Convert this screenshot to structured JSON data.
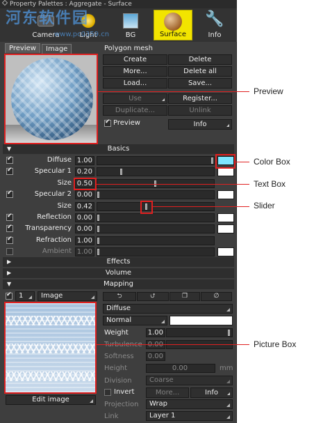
{
  "window": {
    "title": "Property Palettes : Aggregate - Surface"
  },
  "watermark": {
    "text": "河东软件园",
    "url": "www.pc0359.cn"
  },
  "toolbar": {
    "camera": "Camera",
    "light": "Light",
    "bg": "BG",
    "surface": "Surface",
    "info": "Info"
  },
  "tabs": {
    "preview": "Preview",
    "image": "Image"
  },
  "mesh": {
    "title": "Polygon mesh",
    "create": "Create",
    "delete": "Delete",
    "more": "More...",
    "delete_all": "Delete all",
    "load": "Load...",
    "save": "Save...",
    "use": "Use",
    "register": "Register...",
    "duplicate": "Duplicate...",
    "unlink": "Unlink",
    "preview_check": "Preview",
    "info": "Info"
  },
  "basics": {
    "header": "Basics",
    "rows": [
      {
        "label": "Diffuse",
        "value": "1.00",
        "level": 1.0,
        "checked": true,
        "swatch": "#7fe6ff",
        "enabled": true
      },
      {
        "label": "Specular 1",
        "value": "0.20",
        "level": 0.2,
        "checked": true,
        "swatch": "#ffffff",
        "enabled": true
      },
      {
        "label": "Size",
        "value": "0.50",
        "level": 0.5,
        "checked": null,
        "swatch": null,
        "enabled": true
      },
      {
        "label": "Specular 2",
        "value": "0.00",
        "level": 0.0,
        "checked": true,
        "swatch": "#ffffff",
        "enabled": true
      },
      {
        "label": "Size",
        "value": "0.42",
        "level": 0.42,
        "checked": null,
        "swatch": null,
        "enabled": true
      },
      {
        "label": "Reflection",
        "value": "0.00",
        "level": 0.0,
        "checked": true,
        "swatch": "#ffffff",
        "enabled": true
      },
      {
        "label": "Transparency",
        "value": "0.00",
        "level": 0.0,
        "checked": true,
        "swatch": "#ffffff",
        "enabled": true
      },
      {
        "label": "Refraction",
        "value": "1.00",
        "level": 0.0,
        "checked": true,
        "swatch": null,
        "enabled": true
      },
      {
        "label": "Ambient",
        "value": "1.00",
        "level": 0.0,
        "checked": false,
        "swatch": "#ffffff",
        "enabled": false
      }
    ]
  },
  "sections": {
    "effects": "Effects",
    "volume": "Volume",
    "mapping": "Mapping"
  },
  "mapping": {
    "layer_num": "1",
    "type": "Image",
    "target": "Diffuse",
    "blend": "Normal",
    "weight_label": "Weight",
    "weight_value": "1.00",
    "weight_level": 1.0,
    "turbulence_label": "Turbulence",
    "turbulence_value": "0.00",
    "softness_label": "Softness",
    "softness_value": "0.00",
    "height_label": "Height",
    "height_value": "0.00",
    "height_unit": "mm",
    "division_label": "Division",
    "division_value": "Coarse",
    "invert_label": "Invert",
    "more": "More...",
    "info": "Info",
    "projection_label": "Projection",
    "projection_value": "Wrap",
    "link_label": "Link",
    "link_value": "Layer 1",
    "edit_image": "Edit image"
  },
  "callouts": {
    "preview": "Preview",
    "color_box": "Color Box",
    "text_box": "Text Box",
    "slider": "Slider",
    "picture_box": "Picture Box"
  },
  "colors": {
    "accent": "#f2e400",
    "highlight": "#e02020",
    "diffuse_swatch": "#7fe6ff"
  }
}
